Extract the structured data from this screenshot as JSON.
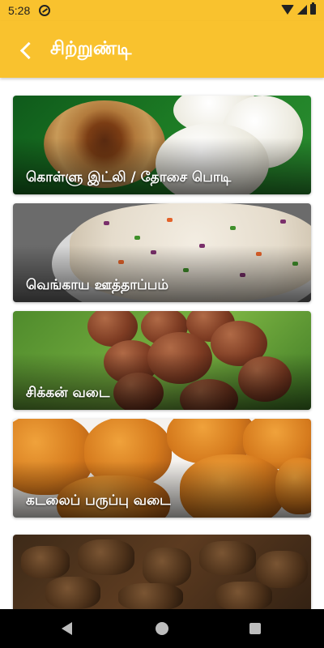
{
  "status_bar": {
    "time": "5:28"
  },
  "app_bar": {
    "title": "சிற்றுண்டி"
  },
  "recipes": [
    {
      "label": "கொள்ளு இட்லி / தோசை பொடி"
    },
    {
      "label": "வெங்காய ஊத்தாப்பம்"
    },
    {
      "label": "சிக்கன் வடை"
    },
    {
      "label": "கடலைப் பருப்பு வடை"
    },
    {
      "label": ""
    }
  ],
  "colors": {
    "accent": "#f9c22e",
    "title_text": "#ffffff",
    "nav_bar": "#000000"
  }
}
